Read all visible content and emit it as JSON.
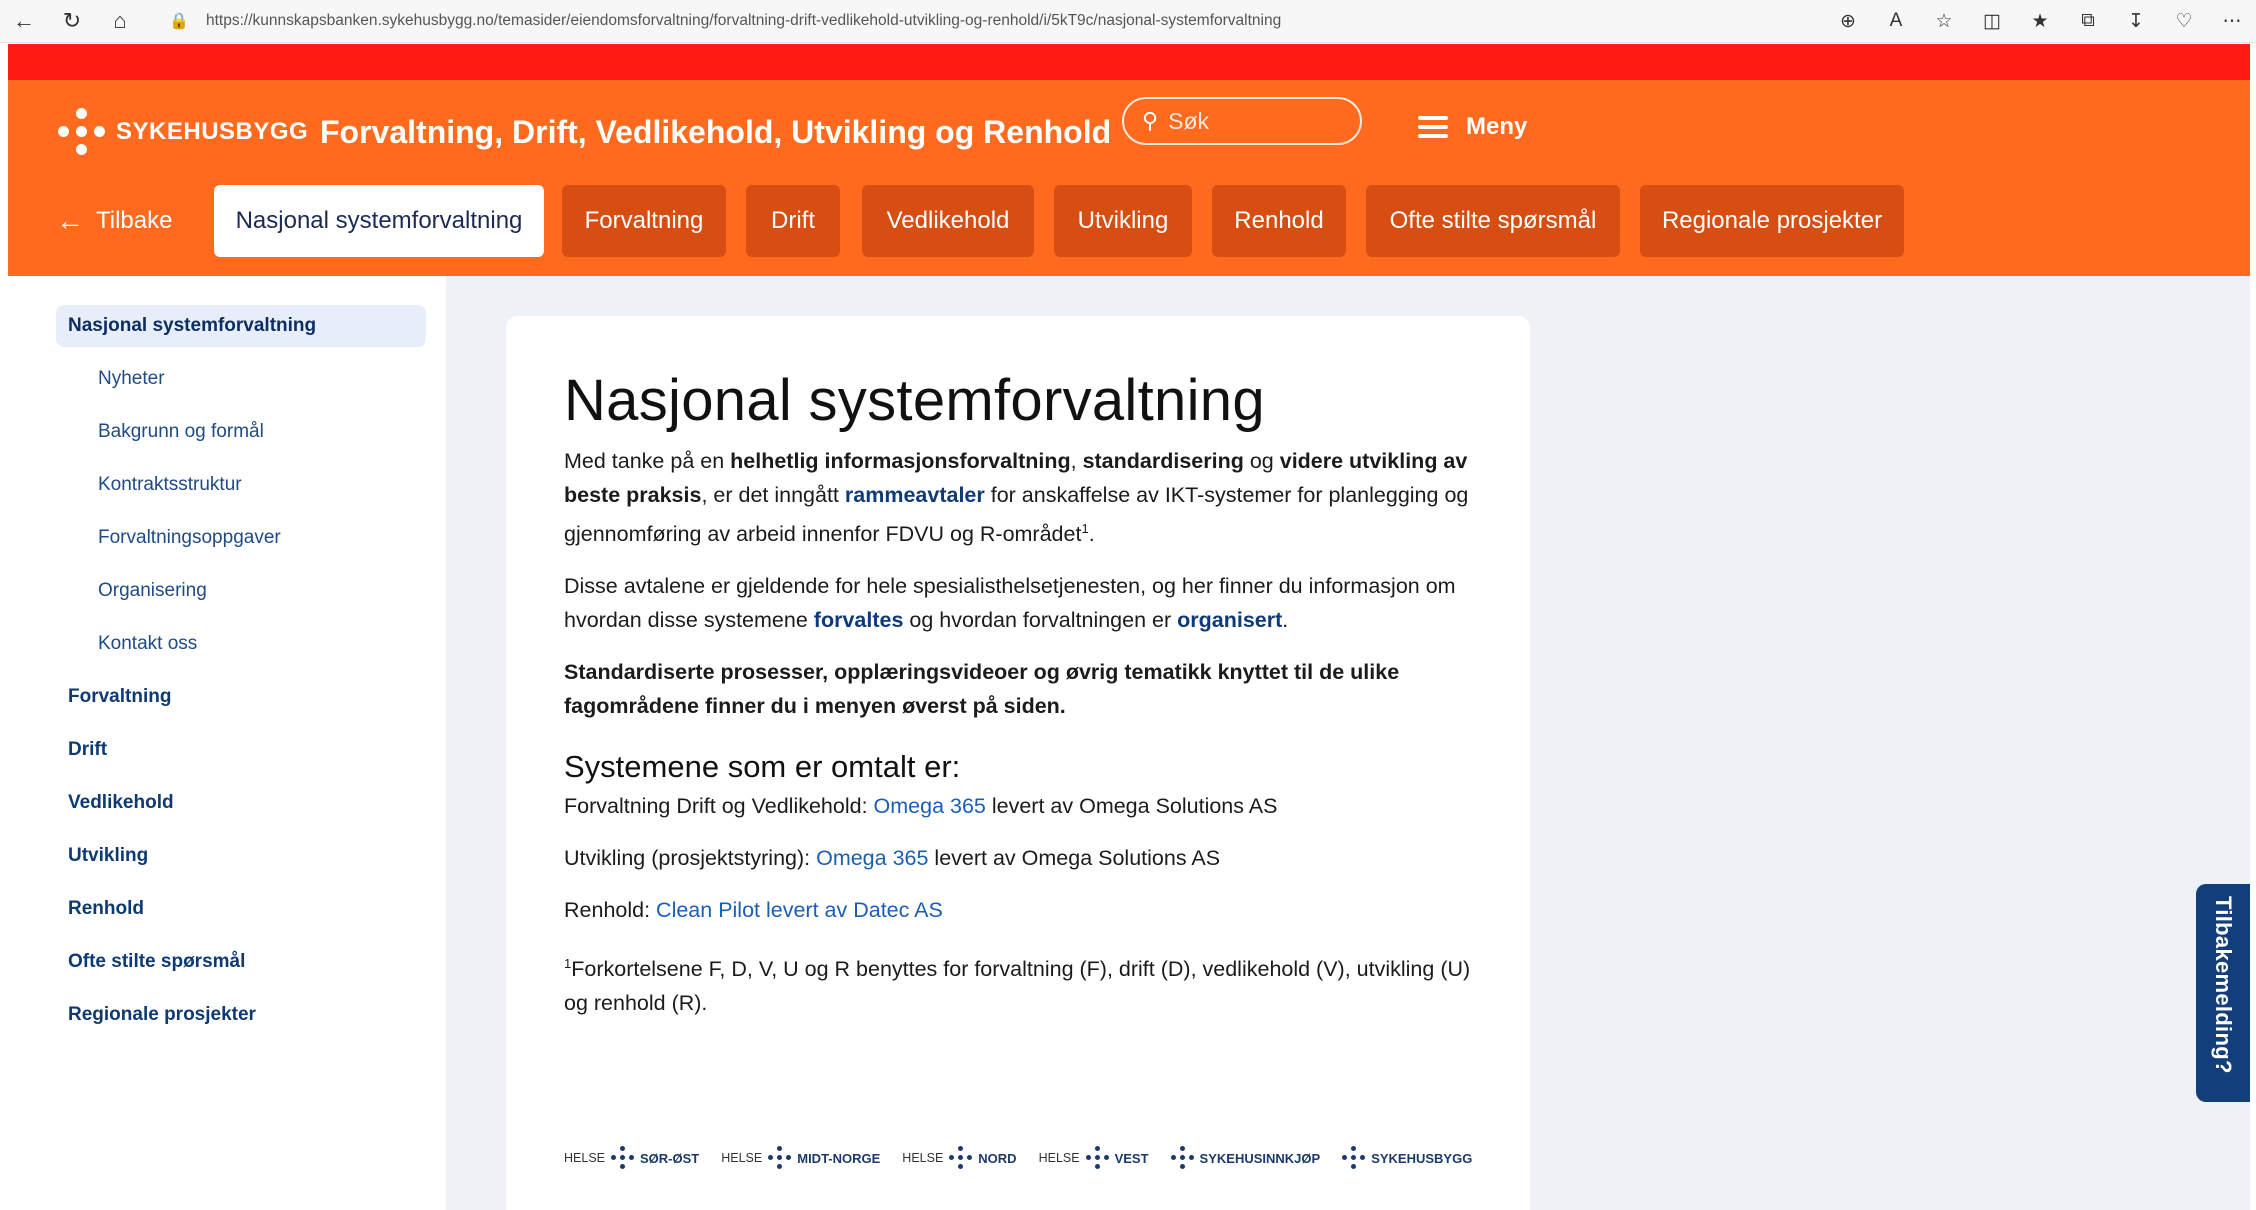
{
  "browser": {
    "url": "https://kunnskapsbanken.sykehusbygg.no/temasider/eiendomsforvaltning/forvaltning-drift-vedlikehold-utvikling-og-renhold/i/5kT9c/nasjonal-systemforvaltning"
  },
  "header": {
    "logo_text": "SYKEHUSBYGG",
    "site_title": "Forvaltning, Drift, Vedlikehold, Utvikling og Renhold",
    "search_placeholder": "Søk",
    "menu_label": "Meny"
  },
  "tabs": {
    "back_label": "Tilbake",
    "items": [
      {
        "label": "Nasjonal systemforvaltning",
        "active": true
      },
      {
        "label": "Forvaltning"
      },
      {
        "label": "Drift"
      },
      {
        "label": "Vedlikehold"
      },
      {
        "label": "Utvikling"
      },
      {
        "label": "Renhold"
      },
      {
        "label": "Ofte stilte spørsmål"
      },
      {
        "label": "Regionale prosjekter"
      }
    ]
  },
  "sidebar": {
    "items": [
      {
        "label": "Nasjonal systemforvaltning",
        "type": "active"
      },
      {
        "label": "Nyheter",
        "type": "sub"
      },
      {
        "label": "Bakgrunn og formål",
        "type": "sub"
      },
      {
        "label": "Kontraktsstruktur",
        "type": "sub"
      },
      {
        "label": "Forvaltningsoppgaver",
        "type": "sub"
      },
      {
        "label": "Organisering",
        "type": "sub"
      },
      {
        "label": "Kontakt oss",
        "type": "sub"
      },
      {
        "label": "Forvaltning",
        "type": "top"
      },
      {
        "label": "Drift",
        "type": "top"
      },
      {
        "label": "Vedlikehold",
        "type": "top"
      },
      {
        "label": "Utvikling",
        "type": "top"
      },
      {
        "label": "Renhold",
        "type": "top"
      },
      {
        "label": "Ofte stilte spørsmål",
        "type": "top"
      },
      {
        "label": "Regionale prosjekter",
        "type": "top"
      }
    ]
  },
  "article": {
    "title": "Nasjonal systemforvaltning",
    "p1": {
      "t1": "Med tanke på en ",
      "b1": "helhetlig informasjonsforvaltning",
      "t2": ", ",
      "b2": "standardisering",
      "t3": " og ",
      "b3": "videre utvikling av beste praksis",
      "t4": ", er det inngått ",
      "link": "rammeavtaler",
      "t5": " for anskaffelse av IKT-systemer for planlegging og gjennomføring av arbeid innenfor FDVU og R-området",
      "sup": "1",
      "t6": "."
    },
    "p2": {
      "t1": "Disse avtalene er gjeldende for hele spesialisthelsetjenesten, og her finner du informasjon om hvordan disse systemene ",
      "link1": "forvaltes",
      "t2": " og hvordan forvaltningen er ",
      "link2": "organisert",
      "t3": "."
    },
    "p3": "Standardiserte prosesser, opplæringsvideoer og øvrig tematikk knyttet til de ulike fagområdene finner du i menyen øverst på siden.",
    "subheading": "Systemene som er omtalt er:",
    "systems": [
      {
        "prefix": "Forvaltning Drift og Vedlikehold: ",
        "link": "Omega 365",
        "suffix": " levert av Omega Solutions AS"
      },
      {
        "prefix": "Utvikling (prosjektstyring): ",
        "link": "Omega 365",
        "suffix": " levert av Omega Solutions AS"
      },
      {
        "prefix": "Renhold: ",
        "link": "Clean Pilot levert av Datec AS",
        "suffix": ""
      }
    ],
    "footnote_sup": "1",
    "footnote": "Forkortelsene F, D, V, U og R benyttes for forvaltning (F), drift (D), vedlikehold (V), utvikling (U) og renhold (R)."
  },
  "partner_logos": [
    {
      "pre": "HELSE",
      "name": "SØR-ØST"
    },
    {
      "pre": "HELSE",
      "name": "MIDT-NORGE"
    },
    {
      "pre": "HELSE",
      "name": "NORD"
    },
    {
      "pre": "HELSE",
      "name": "VEST"
    },
    {
      "pre": "",
      "name": "SYKEHUSINNKJØP"
    },
    {
      "pre": "",
      "name": "SYKEHUSBYGG"
    }
  ],
  "feedback_label": "Tilbakemelding?",
  "colors": {
    "header_orange": "#ff6a1f",
    "top_red": "#ff1a14",
    "tab_dark_orange": "#d64e12",
    "navy": "#123e7c",
    "link_blue": "#1a5fb4"
  }
}
